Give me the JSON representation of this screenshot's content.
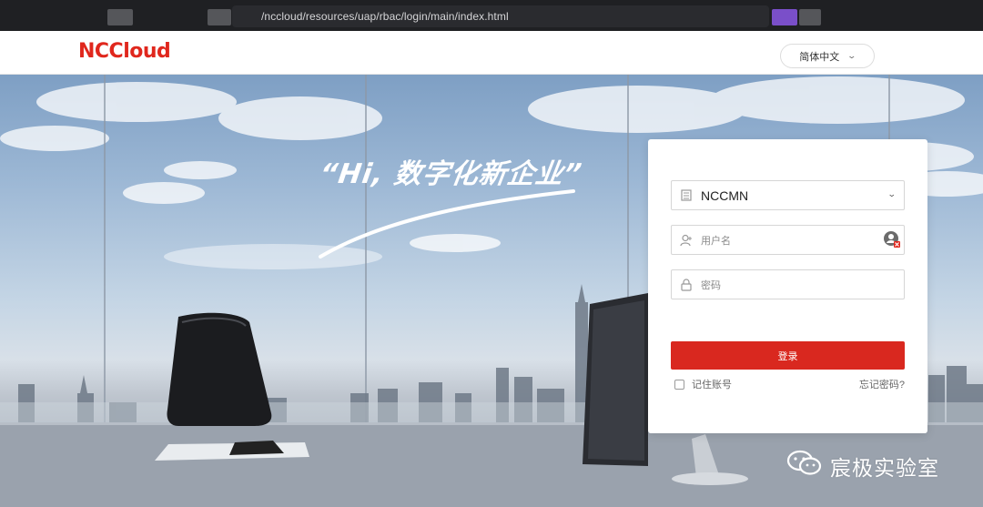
{
  "browser": {
    "url": "/nccloud/resources/uap/rbac/login/main/index.html",
    "accent_extension_color": "#7a4fc9"
  },
  "header": {
    "logo": "NCCloud",
    "logo_color": "#e0271d",
    "language": "简体中文"
  },
  "hero": {
    "slogan": "“Hi, 数字化新企业”"
  },
  "login": {
    "tenant": "NCCMN",
    "username_placeholder": "用户名",
    "password_placeholder": "密码",
    "submit_label": "登录",
    "remember_label": "记住账号",
    "forgot_label": "忘记密码?",
    "button_color": "#d9281f"
  },
  "watermark": {
    "text": "宸极实验室",
    "icon": "wechat-icon"
  }
}
